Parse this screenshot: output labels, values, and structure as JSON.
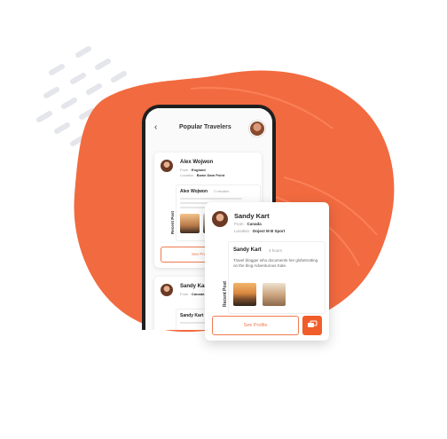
{
  "colors": {
    "accent": "#f15d2a",
    "blob": "#f26a3f",
    "dashes": "#e7e9ee"
  },
  "phone": {
    "title": "Popular Travelers",
    "cards": [
      {
        "name": "Alex Wojwon",
        "from_label": "From",
        "from_value": "England",
        "location_label": "Location",
        "location_value": "Bowe Dam Point",
        "post_author": "Alex Wojwon",
        "post_time": "2 minutes",
        "recent_post_label": "Recent Post",
        "see_profile": "See Profile"
      },
      {
        "name": "Sandy Kart",
        "from_label": "From",
        "from_value": "Canada",
        "post_author": "Sandy Kart"
      }
    ]
  },
  "profile_card": {
    "name": "Sandy Kart",
    "from_label": "From",
    "from_value": "Canada",
    "location_label": "Location",
    "location_value": "Doject M B Sport",
    "post_author": "Sandy Kart",
    "post_time": "3 hours",
    "post_text": "Travel blogger who documents her globetrotting on the blog Adventurous Kate.",
    "recent_post_label": "Recent Post",
    "see_profile": "See Profile",
    "message_icon": "message-icon"
  }
}
